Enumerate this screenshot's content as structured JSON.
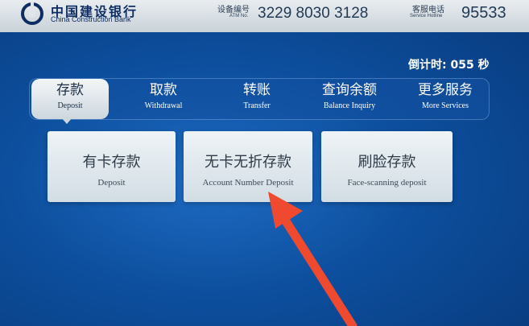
{
  "header": {
    "bank_name_cn": "中国建设银行",
    "bank_name_en": "China Construction Bank",
    "atm_label_cn": "设备编号",
    "atm_label_en": "ATM No.",
    "atm_number": "3229 8030 3128",
    "hotline_label_cn": "客服电话",
    "hotline_label_en": "Service Hotline",
    "hotline_number": "95533"
  },
  "countdown": "倒计时: 055 秒",
  "nav": {
    "items": [
      {
        "cn": "存款",
        "en": "Deposit",
        "active": true
      },
      {
        "cn": "取款",
        "en": "Withdrawal"
      },
      {
        "cn": "转账",
        "en": "Transfer"
      },
      {
        "cn": "查询余额",
        "en": "Balance Inquiry"
      },
      {
        "cn": "更多服务",
        "en": "More Services"
      }
    ]
  },
  "options": [
    {
      "cn": "有卡存款",
      "en": "Deposit"
    },
    {
      "cn": "无卡无折存款",
      "en": "Account Number Deposit"
    },
    {
      "cn": "刷脸存款",
      "en": "Face-scanning deposit"
    }
  ],
  "colors": {
    "background": "#0d4f9e",
    "header": "#dfe5ea",
    "card": "#e3eaef",
    "annotation_arrow": "#ef4a2f"
  }
}
